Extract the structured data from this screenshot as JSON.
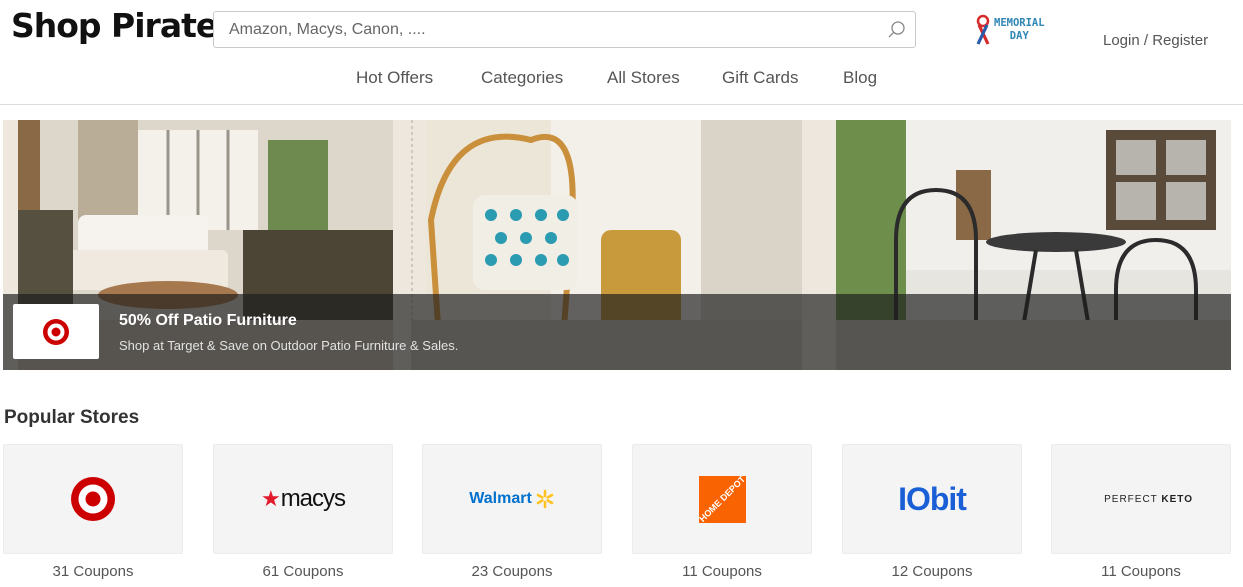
{
  "header": {
    "logo": "Shop Pirate",
    "search_placeholder": "Amazon, Macys, Canon, ....",
    "memorial_line1": "MEMORIAL",
    "memorial_line2": "DAY",
    "login": "Login / Register"
  },
  "nav": {
    "items": [
      {
        "label": "Hot Offers"
      },
      {
        "label": "Categories"
      },
      {
        "label": "All Stores"
      },
      {
        "label": "Gift Cards"
      },
      {
        "label": "Blog"
      }
    ]
  },
  "banner": {
    "title": "50% Off Patio Furniture",
    "subtitle": "Shop at Target & Save on Outdoor Patio Furniture & Sales."
  },
  "popular": {
    "title": "Popular Stores",
    "stores": [
      {
        "name": "Target",
        "logo_icon": "target-logo",
        "coupons": "31 Coupons"
      },
      {
        "name": "Macy's",
        "logo_text": "macys",
        "logo_icon": "macys-logo",
        "coupons": "61 Coupons"
      },
      {
        "name": "Walmart",
        "logo_text": "Walmart",
        "logo_icon": "walmart-logo",
        "coupons": "23 Coupons"
      },
      {
        "name": "Home Depot",
        "logo_text": "HOME DEPOT",
        "logo_icon": "home-depot-logo",
        "coupons": "11 Coupons"
      },
      {
        "name": "IObit",
        "logo_text": "IObit",
        "logo_icon": "iobit-logo",
        "coupons": "12 Coupons"
      },
      {
        "name": "Perfect Keto",
        "logo_text_a": "PERFECT ",
        "logo_text_b": "KETO",
        "logo_icon": "perfect-keto-logo",
        "coupons": "11 Coupons"
      }
    ]
  },
  "colors": {
    "target_red": "#cc0000",
    "walmart_blue": "#0071ce",
    "walmart_yellow": "#ffc220",
    "home_depot_orange": "#f96302",
    "iobit_blue": "#1b5fd6"
  }
}
